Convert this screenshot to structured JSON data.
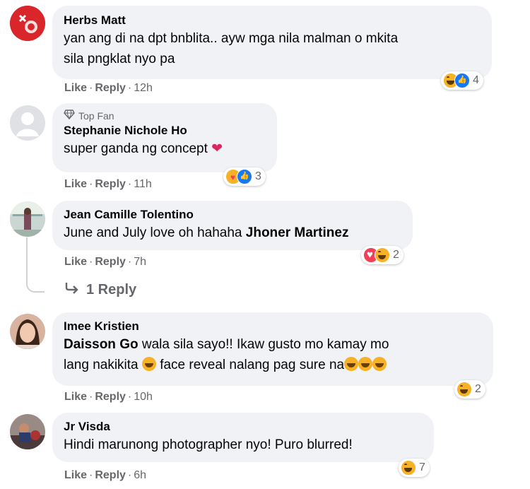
{
  "comments": [
    {
      "name": "Herbs Matt",
      "lines": [
        "yan ang di na dpt bnblita.. ayw mga nila malman o mkita",
        "sila pngklat nyo pa"
      ],
      "like": "Like",
      "reply": "Reply",
      "time": "12h",
      "reactions": [
        "haha",
        "like"
      ],
      "reaction_count": "4"
    },
    {
      "badge": "Top Fan",
      "name": "Stephanie Nichole Ho",
      "text": "super ganda ng concept",
      "like": "Like",
      "reply": "Reply",
      "time": "11h",
      "reactions": [
        "care",
        "like"
      ],
      "reaction_count": "3"
    },
    {
      "name": "Jean Camille Tolentino",
      "text": "June and July love oh hahaha",
      "mention": "Jhoner Martinez",
      "like": "Like",
      "reply": "Reply",
      "time": "7h",
      "reactions": [
        "love",
        "haha"
      ],
      "reaction_count": "2",
      "replies_link": "1 Reply"
    },
    {
      "name": "Imee Kristien",
      "mention": "Daisson Go",
      "text_line1": "wala sila sayo!! Ikaw gusto mo kamay mo",
      "text_line2a": "lang nakikita",
      "text_line2b": "face reveal nalang pag sure na",
      "like": "Like",
      "reply": "Reply",
      "time": "10h",
      "reactions": [
        "haha"
      ],
      "reaction_count": "2"
    },
    {
      "name": "Jr Visda",
      "text": "Hindi marunong photographer nyo! Puro blurred!",
      "like": "Like",
      "reply": "Reply",
      "time": "6h",
      "reactions": [
        "haha"
      ],
      "reaction_count": "7"
    }
  ],
  "separator": "·"
}
